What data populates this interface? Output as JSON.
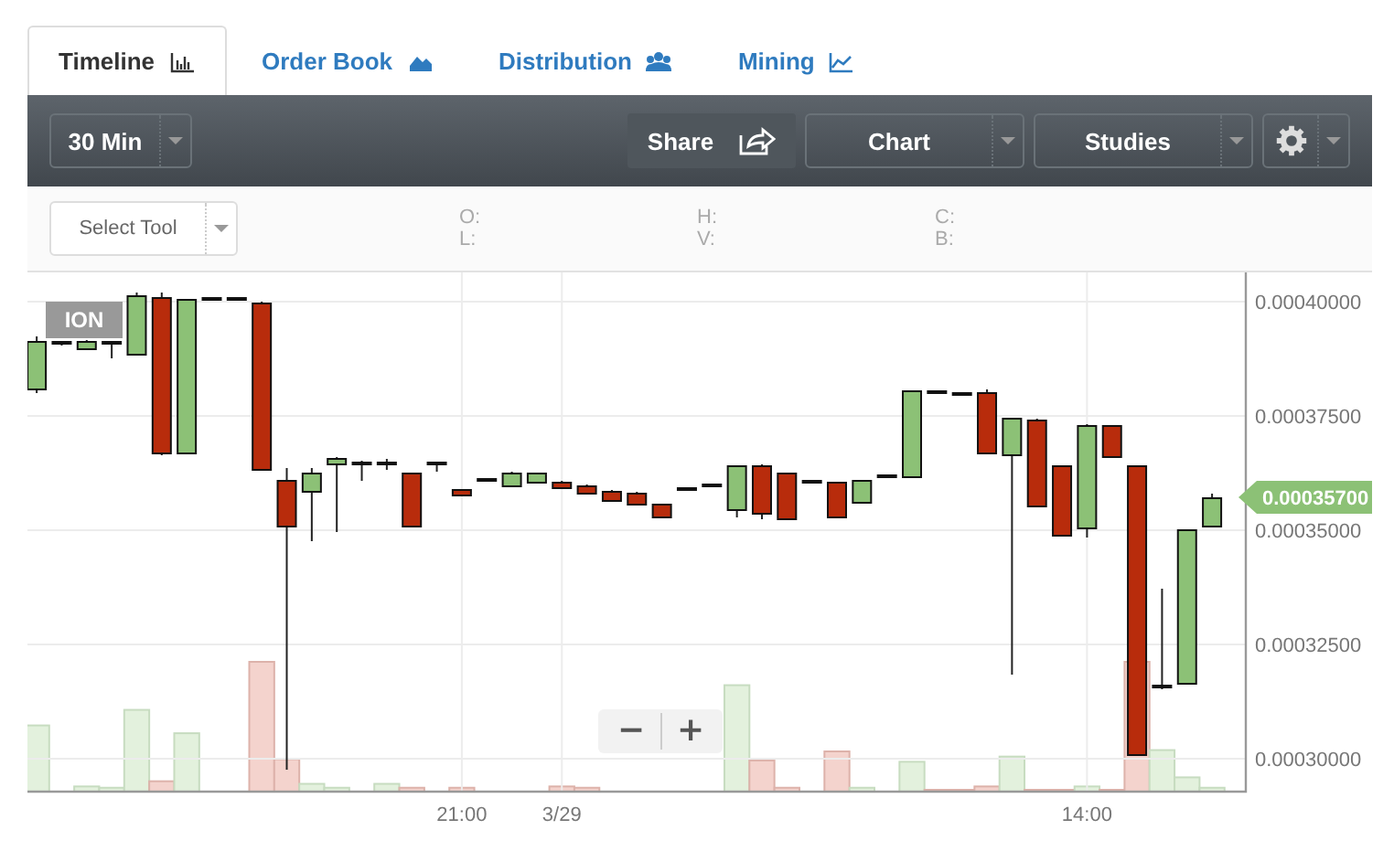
{
  "tabs": [
    {
      "label": "Timeline",
      "selected": true
    },
    {
      "label": "Order Book",
      "selected": false
    },
    {
      "label": "Distribution",
      "selected": false
    },
    {
      "label": "Mining",
      "selected": false
    }
  ],
  "toolbar": {
    "interval": "30 Min",
    "share": "Share",
    "chart_type": "Chart",
    "studies": "Studies"
  },
  "tool_select": "Select Tool",
  "ohlc_labels": [
    "O:",
    "L:",
    "H:",
    "V:",
    "C:",
    "B:"
  ],
  "chart": {
    "symbol": "ION",
    "last_price": "0.00035700",
    "zoom_out": "−",
    "zoom_in": "+",
    "chart_data": {
      "type": "candlestick",
      "categories": [
        null,
        null,
        null,
        null,
        null,
        null,
        null,
        null,
        null,
        null,
        null,
        null,
        null,
        null,
        null,
        null,
        null,
        "21:00",
        null,
        null,
        null,
        "3/29",
        null,
        null,
        null,
        null,
        null,
        null,
        null,
        null,
        null,
        null,
        null,
        null,
        null,
        null,
        null,
        null,
        null,
        null,
        null,
        null,
        "14:00",
        null,
        null,
        null,
        null,
        null
      ],
      "ohlc": [
        [
          0.0003808,
          0.0003924,
          0.00038,
          0.0003912
        ],
        [
          0.0003912,
          0.0003912,
          0.0003904,
          0.0003908
        ],
        [
          0.0003896,
          0.0003916,
          0.0003896,
          0.0003912
        ],
        [
          0.0003908,
          0.0003912,
          0.0003876,
          0.0003912
        ],
        [
          0.0003884,
          0.000402,
          0.0003884,
          0.0004012
        ],
        [
          0.0004008,
          0.000402,
          0.0003664,
          0.0003668
        ],
        [
          0.0003668,
          0.0004004,
          0.0003668,
          0.0004004
        ],
        [
          0.0004008,
          0.0004008,
          0.0004008,
          0.0004008
        ],
        [
          0.0004008,
          0.0004008,
          0.0004008,
          0.0004008
        ],
        [
          0.0003996,
          0.0004,
          0.0003632,
          0.0003632
        ],
        [
          0.0003608,
          0.0003636,
          0.0002976,
          0.0003508
        ],
        [
          0.0003584,
          0.0003636,
          0.0003476,
          0.0003624
        ],
        [
          0.0003644,
          0.000366,
          0.0003496,
          0.0003656
        ],
        [
          0.0003648,
          0.0003652,
          0.0003608,
          0.0003644
        ],
        [
          0.0003644,
          0.0003656,
          0.0003632,
          0.0003648
        ],
        [
          0.0003624,
          0.0003624,
          0.0003508,
          0.0003508
        ],
        [
          0.0003644,
          0.0003648,
          0.0003628,
          0.0003648
        ],
        [
          0.0003588,
          0.0003588,
          0.0003576,
          0.0003576
        ],
        [
          0.0003608,
          0.0003612,
          0.0003608,
          0.0003612
        ],
        [
          0.0003596,
          0.0003628,
          0.0003596,
          0.0003624
        ],
        [
          0.0003604,
          0.0003624,
          0.0003604,
          0.0003624
        ],
        [
          0.0003604,
          0.0003608,
          0.0003592,
          0.0003592
        ],
        [
          0.0003596,
          0.00036,
          0.000358,
          0.000358
        ],
        [
          0.0003584,
          0.0003588,
          0.0003564,
          0.0003564
        ],
        [
          0.000358,
          0.0003584,
          0.0003556,
          0.0003556
        ],
        [
          0.0003556,
          0.0003556,
          0.0003528,
          0.0003528
        ],
        [
          0.0003588,
          0.0003592,
          0.0003588,
          0.0003592
        ],
        [
          0.0003596,
          0.00036,
          0.0003596,
          0.00036
        ],
        [
          0.0003544,
          0.000364,
          0.0003528,
          0.000364
        ],
        [
          0.000364,
          0.0003644,
          0.0003524,
          0.0003536
        ],
        [
          0.0003624,
          0.0003624,
          0.0003524,
          0.0003524
        ],
        [
          0.0003604,
          0.0003608,
          0.0003604,
          0.0003608
        ],
        [
          0.0003604,
          0.0003604,
          0.0003528,
          0.0003528
        ],
        [
          0.000356,
          0.0003608,
          0.000356,
          0.0003608
        ],
        [
          0.0003616,
          0.000362,
          0.0003616,
          0.000362
        ],
        [
          0.0003616,
          0.0003804,
          0.0003616,
          0.0003804
        ],
        [
          0.0003804,
          0.0003804,
          0.00038,
          0.00038
        ],
        [
          0.00038,
          0.00038,
          0.0003796,
          0.0003796
        ],
        [
          0.00038,
          0.0003808,
          0.0003668,
          0.0003668
        ],
        [
          0.0003664,
          0.0003744,
          0.0003184,
          0.0003744
        ],
        [
          0.000374,
          0.0003744,
          0.0003552,
          0.0003552
        ],
        [
          0.000364,
          0.000364,
          0.0003488,
          0.0003488
        ],
        [
          0.0003504,
          0.0003732,
          0.0003484,
          0.0003728
        ],
        [
          0.0003728,
          0.0003728,
          0.000366,
          0.000366
        ],
        [
          0.000364,
          0.000364,
          0.0003008,
          0.0003008
        ],
        [
          0.0003156,
          0.0003372,
          0.0003152,
          0.000316
        ],
        [
          0.0003164,
          0.00035,
          0.0003164,
          0.00035
        ],
        [
          0.0003508,
          0.000358,
          0.0003508,
          0.000357
        ]
      ],
      "grid": true,
      "ylim": [
        0.0002928,
        0.0004064
      ],
      "yticks": [
        {
          "value": 0.0004,
          "label": "0.00040000"
        },
        {
          "value": 0.000375,
          "label": "0.00037500"
        },
        {
          "value": 0.00035,
          "label": "0.00035000"
        },
        {
          "value": 0.000325,
          "label": "0.00032500"
        },
        {
          "value": 0.0003,
          "label": "0.00030000"
        }
      ]
    }
  }
}
